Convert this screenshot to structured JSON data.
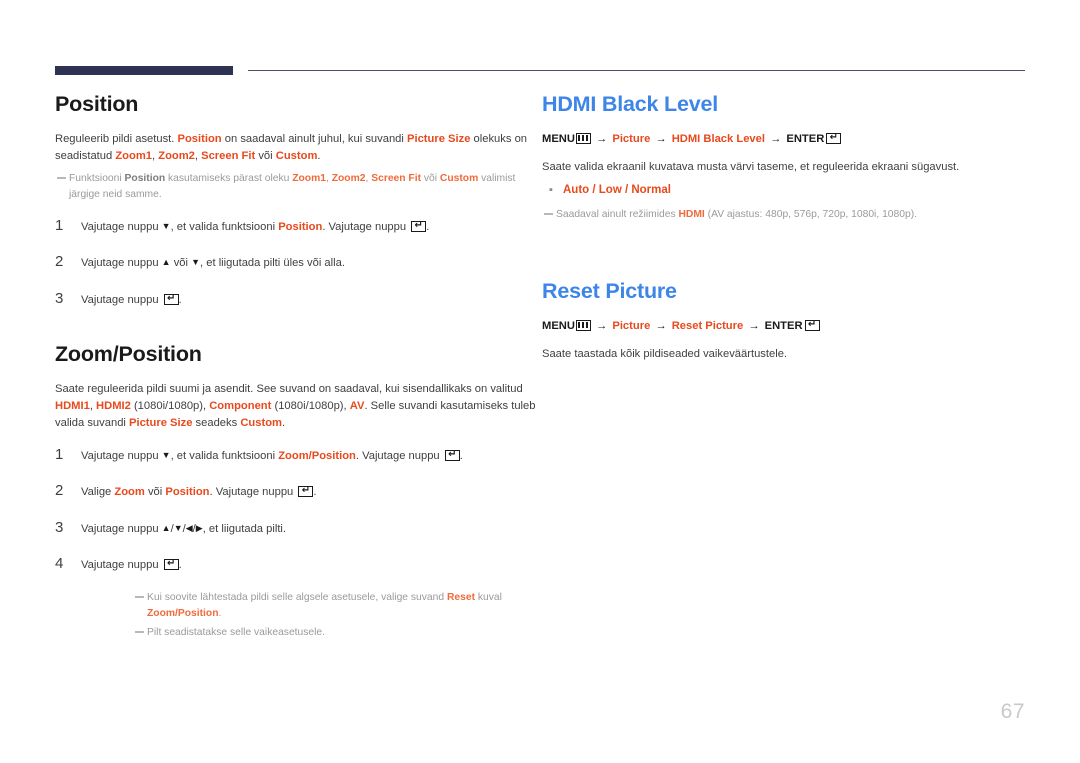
{
  "page": {
    "number": "67",
    "accent_blue": "#3d85e8",
    "accent_orange": "#e8491d",
    "header_bar_color": "#2e3354"
  },
  "left_column": {
    "position_section": {
      "heading": "Position",
      "intro_parts": [
        {
          "t": "Reguleerib pildi asetust. ",
          "s": "normal"
        },
        {
          "t": "Position",
          "s": "kw"
        },
        {
          "t": " on saadaval ainult juhul, kui suvandi ",
          "s": "normal"
        },
        {
          "t": "Picture Size",
          "s": "kw"
        },
        {
          "t": " olekuks on seadistatud ",
          "s": "normal"
        },
        {
          "t": "Zoom1",
          "s": "kw"
        },
        {
          "t": ", ",
          "s": "normal"
        },
        {
          "t": "Zoom2",
          "s": "kw"
        },
        {
          "t": ", ",
          "s": "normal"
        },
        {
          "t": "Screen Fit",
          "s": "kw"
        },
        {
          "t": " või ",
          "s": "normal"
        },
        {
          "t": "Custom",
          "s": "kw"
        },
        {
          "t": ".",
          "s": "normal"
        }
      ],
      "note": [
        {
          "t": "Funktsiooni ",
          "s": "normal"
        },
        {
          "t": "Position",
          "s": "bkdim"
        },
        {
          "t": " kasutamiseks pärast oleku ",
          "s": "normal"
        },
        {
          "t": "Zoom1",
          "s": "kw"
        },
        {
          "t": ", ",
          "s": "normal"
        },
        {
          "t": "Zoom2",
          "s": "kw"
        },
        {
          "t": ", ",
          "s": "normal"
        },
        {
          "t": "Screen Fit",
          "s": "kw"
        },
        {
          "t": " või ",
          "s": "normal"
        },
        {
          "t": "Custom",
          "s": "kw"
        },
        {
          "t": " valimist järgige neid samme.",
          "s": "normal"
        }
      ],
      "steps": [
        {
          "num": "1",
          "parts": [
            {
              "t": "Vajutage nuppu ",
              "s": "normal"
            },
            {
              "t": "▼",
              "s": "tri"
            },
            {
              "t": ", et valida funktsiooni ",
              "s": "normal"
            },
            {
              "t": "Position",
              "s": "kw"
            },
            {
              "t": ". Vajutage nuppu ",
              "s": "normal"
            },
            {
              "t": "ENTER_ICON",
              "s": "icon-enter"
            },
            {
              "t": ".",
              "s": "normal"
            }
          ]
        },
        {
          "num": "2",
          "parts": [
            {
              "t": "Vajutage nuppu ",
              "s": "normal"
            },
            {
              "t": "▲",
              "s": "tri"
            },
            {
              "t": " või ",
              "s": "normal"
            },
            {
              "t": "▼",
              "s": "tri"
            },
            {
              "t": ", et liigutada pilti üles või alla.",
              "s": "normal"
            }
          ]
        },
        {
          "num": "3",
          "parts": [
            {
              "t": "Vajutage nuppu ",
              "s": "normal"
            },
            {
              "t": "ENTER_ICON",
              "s": "icon-enter"
            },
            {
              "t": ".",
              "s": "normal"
            }
          ]
        }
      ]
    },
    "zoom_position_section": {
      "heading": "Zoom/Position",
      "intro_parts": [
        {
          "t": "Saate reguleerida pildi suumi ja asendit. See suvand on saadaval, kui sisendallikaks on valitud ",
          "s": "normal"
        },
        {
          "t": "HDMI1",
          "s": "kw"
        },
        {
          "t": ", ",
          "s": "normal"
        },
        {
          "t": "HDMI2",
          "s": "kw"
        },
        {
          "t": " (1080i/1080p), ",
          "s": "normal"
        },
        {
          "t": "Component",
          "s": "kw"
        },
        {
          "t": " (1080i/1080p), ",
          "s": "normal"
        },
        {
          "t": "AV",
          "s": "kw"
        },
        {
          "t": ". Selle suvandi kasutamiseks tuleb valida suvandi ",
          "s": "normal"
        },
        {
          "t": "Picture Size",
          "s": "kw"
        },
        {
          "t": " seadeks ",
          "s": "normal"
        },
        {
          "t": "Custom",
          "s": "kw"
        },
        {
          "t": ".",
          "s": "normal"
        }
      ],
      "steps": [
        {
          "num": "1",
          "parts": [
            {
              "t": "Vajutage nuppu ",
              "s": "normal"
            },
            {
              "t": "▼",
              "s": "tri"
            },
            {
              "t": ", et valida funktsiooni ",
              "s": "normal"
            },
            {
              "t": "Zoom/Position",
              "s": "kw"
            },
            {
              "t": ". Vajutage nuppu ",
              "s": "normal"
            },
            {
              "t": "ENTER_ICON",
              "s": "icon-enter"
            },
            {
              "t": ".",
              "s": "normal"
            }
          ]
        },
        {
          "num": "2",
          "parts": [
            {
              "t": "Valige ",
              "s": "normal"
            },
            {
              "t": "Zoom",
              "s": "kw"
            },
            {
              "t": " või ",
              "s": "normal"
            },
            {
              "t": "Position",
              "s": "kw"
            },
            {
              "t": ". Vajutage nuppu ",
              "s": "normal"
            },
            {
              "t": "ENTER_ICON",
              "s": "icon-enter"
            },
            {
              "t": ".",
              "s": "normal"
            }
          ]
        },
        {
          "num": "3",
          "parts": [
            {
              "t": "Vajutage nuppu ",
              "s": "normal"
            },
            {
              "t": "▲",
              "s": "tri"
            },
            {
              "t": "/",
              "s": "normal"
            },
            {
              "t": "▼",
              "s": "tri"
            },
            {
              "t": "/",
              "s": "normal"
            },
            {
              "t": "◀",
              "s": "tri"
            },
            {
              "t": "/",
              "s": "normal"
            },
            {
              "t": "▶",
              "s": "tri"
            },
            {
              "t": ", et liigutada pilti.",
              "s": "normal"
            }
          ]
        },
        {
          "num": "4",
          "parts": [
            {
              "t": "Vajutage nuppu ",
              "s": "normal"
            },
            {
              "t": "ENTER_ICON",
              "s": "icon-enter"
            },
            {
              "t": ".",
              "s": "normal"
            }
          ]
        }
      ],
      "notes": [
        [
          {
            "t": "Kui soovite lähtestada pildi selle algsele asetusele, valige suvand ",
            "s": "normal"
          },
          {
            "t": "Reset",
            "s": "kw"
          },
          {
            "t": " kuval ",
            "s": "normal"
          },
          {
            "t": "Zoom/Position",
            "s": "kw"
          },
          {
            "t": ".",
            "s": "normal"
          }
        ],
        [
          {
            "t": "Pilt seadistatakse selle vaikeasetusele.",
            "s": "normal"
          }
        ]
      ]
    }
  },
  "right_column": {
    "hdmi_black_level_section": {
      "heading": "HDMI Black Level",
      "menu_path": {
        "menu_label": "MENU",
        "menu_icon": "menu-grid-icon",
        "arrow": "→",
        "items": [
          "Picture",
          "HDMI Black Level"
        ],
        "enter_label": "ENTER",
        "enter_icon": "enter-key-icon"
      },
      "body": "Saate valida ekraanil kuvatava musta värvi taseme, et reguleerida ekraani sügavust.",
      "bullet": "Auto / Low / Normal",
      "note": [
        {
          "t": "Saadaval ainult režiimides ",
          "s": "normal"
        },
        {
          "t": "HDMI",
          "s": "kw"
        },
        {
          "t": " (AV ajastus: 480p, 576p, 720p, 1080i, 1080p).",
          "s": "normal"
        }
      ]
    },
    "reset_picture_section": {
      "heading": "Reset Picture",
      "menu_path": {
        "menu_label": "MENU",
        "menu_icon": "menu-grid-icon",
        "arrow": "→",
        "items": [
          "Picture",
          "Reset Picture"
        ],
        "enter_label": "ENTER",
        "enter_icon": "enter-key-icon"
      },
      "body": "Saate taastada kõik pildiseaded vaikeväärtustele."
    }
  }
}
